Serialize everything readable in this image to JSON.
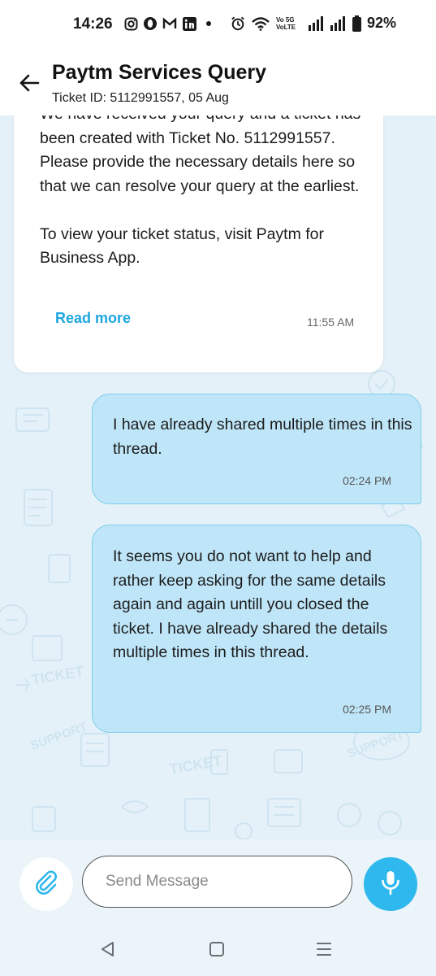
{
  "status_bar": {
    "time": "14:26",
    "network_label": "Vo 5G\nVoLTE",
    "battery": "92%"
  },
  "header": {
    "title": "Paytm Services Query",
    "subtitle": "Ticket ID: 5112991557, 05 Aug"
  },
  "messages": [
    {
      "sender": "support",
      "text": "We have received your query and a ticket has been created with Ticket No. 5112991557. Please provide the necessary details here so that we can resolve your query at the earliest.\n\nTo view your ticket status, visit Paytm for Business App.",
      "action": "Read more",
      "time": "11:55 AM"
    },
    {
      "sender": "user",
      "text": "I have already shared multiple times in this thread.",
      "time": "02:24 PM"
    },
    {
      "sender": "user",
      "text": "It seems you do not want to help and rather keep asking for the same details again and again untill you closed the ticket. I have already shared the details multiple times in this thread.",
      "time": "02:25 PM"
    }
  ],
  "composer": {
    "placeholder": "Send Message"
  },
  "colors": {
    "accent": "#2fb8ee",
    "bubble": "#bfe6f8",
    "link": "#1ea7e0"
  }
}
